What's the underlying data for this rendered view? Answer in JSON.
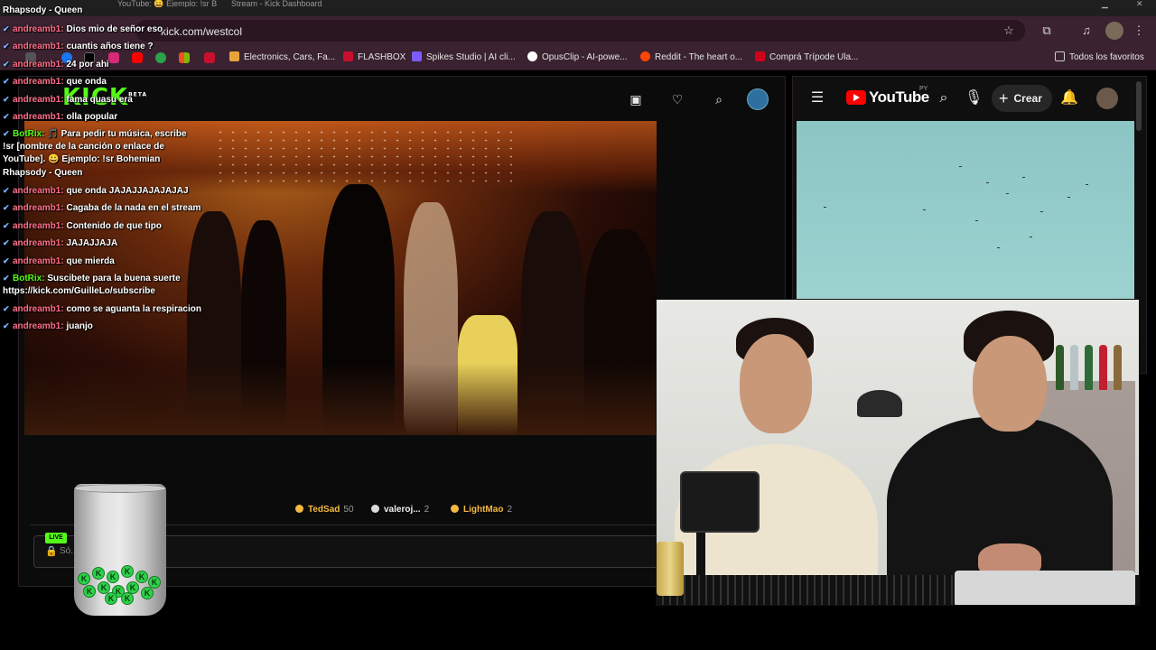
{
  "browser": {
    "tabs": [
      {
        "label": "YouTube: 😀 Ejemplo: !sr Bohemian Rhapsody - Queen"
      },
      {
        "label": "Stream - Kick Dashboard"
      }
    ],
    "url": "kick.com/westcol",
    "bookmarks": [
      {
        "label": "Electronics, Cars, Fa...",
        "color": "#e8a33b"
      },
      {
        "label": "FLASHBOX",
        "color": "#c8102e"
      },
      {
        "label": "Spikes Studio | AI cli...",
        "color": "#7b5cff"
      },
      {
        "label": "OpusClip - AI-powe...",
        "color": "#ffffff"
      },
      {
        "label": "Reddit - The heart o...",
        "color": "#ff4500"
      },
      {
        "label": "Comprá Trípode Ula...",
        "color": "#d0021b"
      }
    ],
    "bookmarks_folder": "Todos los favoritos"
  },
  "kick": {
    "logo": "KICK",
    "logo_sup": "BETA",
    "leaderboard": [
      {
        "name": "TedSad",
        "count": "50",
        "color": "#f5b942"
      },
      {
        "name": "valeroj...",
        "count": "2",
        "color": "#dcdcdc"
      },
      {
        "name": "LightMao",
        "count": "2",
        "color": "#f5b942"
      }
    ],
    "chat_placeholder": "Só..."
  },
  "youtube": {
    "logo": "YouTube",
    "country": "PY",
    "create_label": "Crear"
  },
  "chat": {
    "top_line": "Rhapsody - Queen",
    "messages": [
      {
        "user": "andreamb1:",
        "text": "Dios mio de señor eso",
        "bot": false
      },
      {
        "user": "andreamb1:",
        "text": "cuantis años tiene ?",
        "bot": false
      },
      {
        "user": "andreamb1:",
        "text": "24 por ahi",
        "bot": false
      },
      {
        "user": "andreamb1:",
        "text": "que onda",
        "bot": false
      },
      {
        "user": "andreamb1:",
        "text": "fama quasu era",
        "bot": false
      },
      {
        "user": "andreamb1:",
        "text": "olla popular",
        "bot": false
      },
      {
        "user": "BotRix:",
        "text": "🎵 Para pedir tu música, escribe",
        "bot": true
      },
      {
        "user": "andreamb1:",
        "text": "que onda JAJAJJAJAJAJAJ",
        "bot": false
      },
      {
        "user": "andreamb1:",
        "text": "Cagaba de la nada en el stream",
        "bot": false
      },
      {
        "user": "andreamb1:",
        "text": "Contenido de que tipo",
        "bot": false
      },
      {
        "user": "andreamb1:",
        "text": "JAJAJJAJA",
        "bot": false
      },
      {
        "user": "andreamb1:",
        "text": "que mierda",
        "bot": false
      },
      {
        "user": "BotRix:",
        "text": "Suscibete para la buena suerte",
        "bot": true
      },
      {
        "user": "andreamb1:",
        "text": "como se aguanta la respiracion",
        "bot": false
      },
      {
        "user": "andreamb1:",
        "text": "juanjo",
        "bot": false
      }
    ],
    "botrix_cont_1": "!sr [nombre de la canción o enlace de",
    "botrix_cont_2": "YouTube]. 😀 Ejemplo: !sr Bohemian",
    "botrix_cont_3": "Rhapsody - Queen",
    "botrix2_cont": "https://kick.com/GuilleLo/subscribe"
  },
  "widget": {
    "live_label": "LIVE",
    "chip_glyph": "K"
  },
  "colors": {
    "kick_green": "#53fc18",
    "chat_user": "#ff6f8a",
    "yt_red": "#ff0000"
  }
}
